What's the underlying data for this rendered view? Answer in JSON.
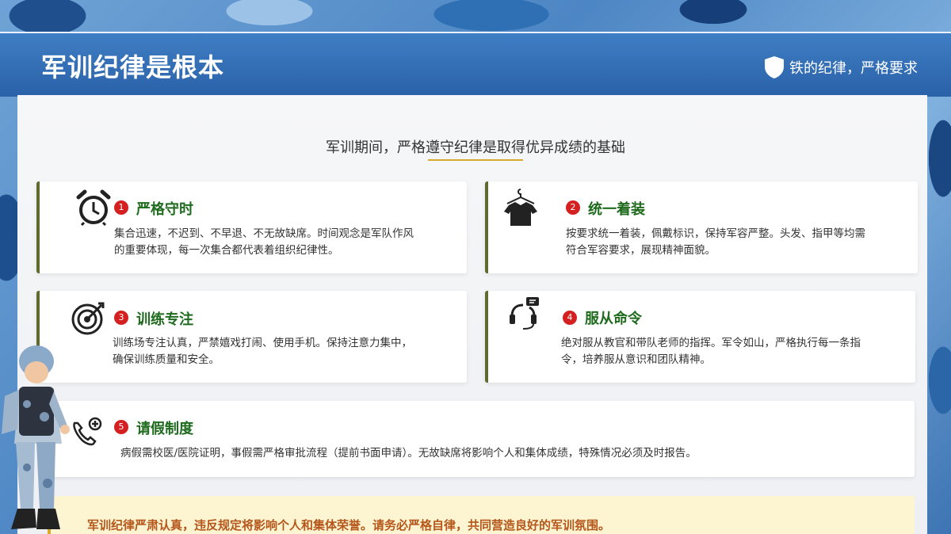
{
  "header": {
    "title": "军训纪律是根本",
    "tagline": "铁的纪律，严格要求"
  },
  "subtitle": "军训期间，严格遵守纪律是取得优异成绩的基础",
  "cards": [
    {
      "num": "1",
      "title": "严格守时",
      "icon": "alarm-clock-icon",
      "text1": "集合迅速，不迟到、不早退、不无故缺席。时间观念是军队作风",
      "text2": "的重要体现，每一次集合都代表着组织纪律性。"
    },
    {
      "num": "2",
      "title": "统一着装",
      "icon": "shirt-hanger-icon",
      "text1": "按要求统一着装，佩戴标识，保持军容严整。头发、指甲等均需",
      "text2": "符合军容要求，展现精神面貌。"
    },
    {
      "num": "3",
      "title": "训练专注",
      "icon": "target-icon",
      "text1": "训练场专注认真，严禁嬉戏打闹、使用手机。保持注意力集中，",
      "text2": "确保训练质量和安全。"
    },
    {
      "num": "4",
      "title": "服从命令",
      "icon": "headset-icon",
      "text1": "绝对服从教官和带队老师的指挥。军令如山，严格执行每一条指",
      "text2": "令，培养服从意识和团队精神。"
    },
    {
      "num": "5",
      "title": "请假制度",
      "icon": "phone-medical-icon",
      "text1": "病假需校医/医院证明，事假需严格审批流程（提前书面申请）。无故缺席将影响个人和集体成绩，特殊情况必须及时报告。"
    }
  ],
  "banner": "军训纪律严肃认真，违反规定将影响个人和集体荣誉。请务必严格自律，共同营造良好的军训氛围。",
  "colors": {
    "accent_red": "#d42020",
    "title_green": "#1e6b1e",
    "header_blue": "#2a61a8",
    "gold": "#d8a92d"
  }
}
